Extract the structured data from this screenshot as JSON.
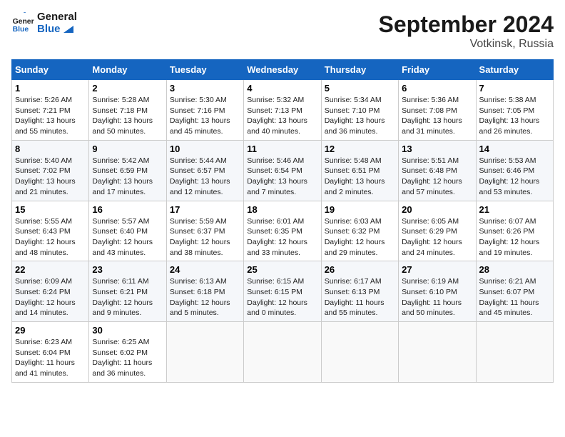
{
  "logo": {
    "line1": "General",
    "line2": "Blue"
  },
  "title": "September 2024",
  "subtitle": "Votkinsk, Russia",
  "headers": [
    "Sunday",
    "Monday",
    "Tuesday",
    "Wednesday",
    "Thursday",
    "Friday",
    "Saturday"
  ],
  "weeks": [
    [
      {
        "day": "1",
        "info": "Sunrise: 5:26 AM\nSunset: 7:21 PM\nDaylight: 13 hours\nand 55 minutes."
      },
      {
        "day": "2",
        "info": "Sunrise: 5:28 AM\nSunset: 7:18 PM\nDaylight: 13 hours\nand 50 minutes."
      },
      {
        "day": "3",
        "info": "Sunrise: 5:30 AM\nSunset: 7:16 PM\nDaylight: 13 hours\nand 45 minutes."
      },
      {
        "day": "4",
        "info": "Sunrise: 5:32 AM\nSunset: 7:13 PM\nDaylight: 13 hours\nand 40 minutes."
      },
      {
        "day": "5",
        "info": "Sunrise: 5:34 AM\nSunset: 7:10 PM\nDaylight: 13 hours\nand 36 minutes."
      },
      {
        "day": "6",
        "info": "Sunrise: 5:36 AM\nSunset: 7:08 PM\nDaylight: 13 hours\nand 31 minutes."
      },
      {
        "day": "7",
        "info": "Sunrise: 5:38 AM\nSunset: 7:05 PM\nDaylight: 13 hours\nand 26 minutes."
      }
    ],
    [
      {
        "day": "8",
        "info": "Sunrise: 5:40 AM\nSunset: 7:02 PM\nDaylight: 13 hours\nand 21 minutes."
      },
      {
        "day": "9",
        "info": "Sunrise: 5:42 AM\nSunset: 6:59 PM\nDaylight: 13 hours\nand 17 minutes."
      },
      {
        "day": "10",
        "info": "Sunrise: 5:44 AM\nSunset: 6:57 PM\nDaylight: 13 hours\nand 12 minutes."
      },
      {
        "day": "11",
        "info": "Sunrise: 5:46 AM\nSunset: 6:54 PM\nDaylight: 13 hours\nand 7 minutes."
      },
      {
        "day": "12",
        "info": "Sunrise: 5:48 AM\nSunset: 6:51 PM\nDaylight: 13 hours\nand 2 minutes."
      },
      {
        "day": "13",
        "info": "Sunrise: 5:51 AM\nSunset: 6:48 PM\nDaylight: 12 hours\nand 57 minutes."
      },
      {
        "day": "14",
        "info": "Sunrise: 5:53 AM\nSunset: 6:46 PM\nDaylight: 12 hours\nand 53 minutes."
      }
    ],
    [
      {
        "day": "15",
        "info": "Sunrise: 5:55 AM\nSunset: 6:43 PM\nDaylight: 12 hours\nand 48 minutes."
      },
      {
        "day": "16",
        "info": "Sunrise: 5:57 AM\nSunset: 6:40 PM\nDaylight: 12 hours\nand 43 minutes."
      },
      {
        "day": "17",
        "info": "Sunrise: 5:59 AM\nSunset: 6:37 PM\nDaylight: 12 hours\nand 38 minutes."
      },
      {
        "day": "18",
        "info": "Sunrise: 6:01 AM\nSunset: 6:35 PM\nDaylight: 12 hours\nand 33 minutes."
      },
      {
        "day": "19",
        "info": "Sunrise: 6:03 AM\nSunset: 6:32 PM\nDaylight: 12 hours\nand 29 minutes."
      },
      {
        "day": "20",
        "info": "Sunrise: 6:05 AM\nSunset: 6:29 PM\nDaylight: 12 hours\nand 24 minutes."
      },
      {
        "day": "21",
        "info": "Sunrise: 6:07 AM\nSunset: 6:26 PM\nDaylight: 12 hours\nand 19 minutes."
      }
    ],
    [
      {
        "day": "22",
        "info": "Sunrise: 6:09 AM\nSunset: 6:24 PM\nDaylight: 12 hours\nand 14 minutes."
      },
      {
        "day": "23",
        "info": "Sunrise: 6:11 AM\nSunset: 6:21 PM\nDaylight: 12 hours\nand 9 minutes."
      },
      {
        "day": "24",
        "info": "Sunrise: 6:13 AM\nSunset: 6:18 PM\nDaylight: 12 hours\nand 5 minutes."
      },
      {
        "day": "25",
        "info": "Sunrise: 6:15 AM\nSunset: 6:15 PM\nDaylight: 12 hours\nand 0 minutes."
      },
      {
        "day": "26",
        "info": "Sunrise: 6:17 AM\nSunset: 6:13 PM\nDaylight: 11 hours\nand 55 minutes."
      },
      {
        "day": "27",
        "info": "Sunrise: 6:19 AM\nSunset: 6:10 PM\nDaylight: 11 hours\nand 50 minutes."
      },
      {
        "day": "28",
        "info": "Sunrise: 6:21 AM\nSunset: 6:07 PM\nDaylight: 11 hours\nand 45 minutes."
      }
    ],
    [
      {
        "day": "29",
        "info": "Sunrise: 6:23 AM\nSunset: 6:04 PM\nDaylight: 11 hours\nand 41 minutes."
      },
      {
        "day": "30",
        "info": "Sunrise: 6:25 AM\nSunset: 6:02 PM\nDaylight: 11 hours\nand 36 minutes."
      },
      null,
      null,
      null,
      null,
      null
    ]
  ]
}
